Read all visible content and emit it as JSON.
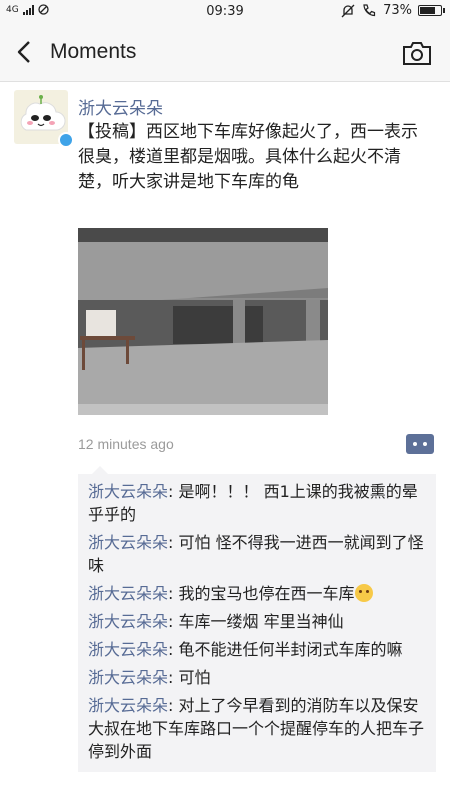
{
  "status_bar": {
    "network": "4G",
    "time": "09:39",
    "battery": "73%",
    "battery_level": 0.73
  },
  "nav": {
    "title": "Moments"
  },
  "post": {
    "author": "浙大云朵朵",
    "text": "【投稿】西区地下车库好像起火了，西一表示很臭，楼道里都是烟哦。具体什么起火不清楚，听大家讲是地下车库的龟",
    "timestamp": "12 minutes ago"
  },
  "comments": [
    {
      "name": "浙大云朵朵",
      "text": "是啊！！！ 西1上课的我被熏的晕乎乎的"
    },
    {
      "name": "浙大云朵朵",
      "text": "可怕 怪不得我一进西一就闻到了怪味"
    },
    {
      "name": "浙大云朵朵",
      "text": "我的宝马也停在西一车库",
      "emoji": "sad-face"
    },
    {
      "name": "浙大云朵朵",
      "text": "车库一缕烟 牢里当神仙"
    },
    {
      "name": "浙大云朵朵",
      "text": "龟不能进任何半封闭式车库的嘛"
    },
    {
      "name": "浙大云朵朵",
      "text": "可怕"
    },
    {
      "name": "浙大云朵朵",
      "text": "对上了今早看到的消防车以及保安大叔在地下车库路口一个个提醒停车的人把车子停到外面"
    }
  ],
  "colors": {
    "link": "#576b95",
    "comment_bg": "#f3f3f5",
    "comment_button": "#5d7098"
  }
}
